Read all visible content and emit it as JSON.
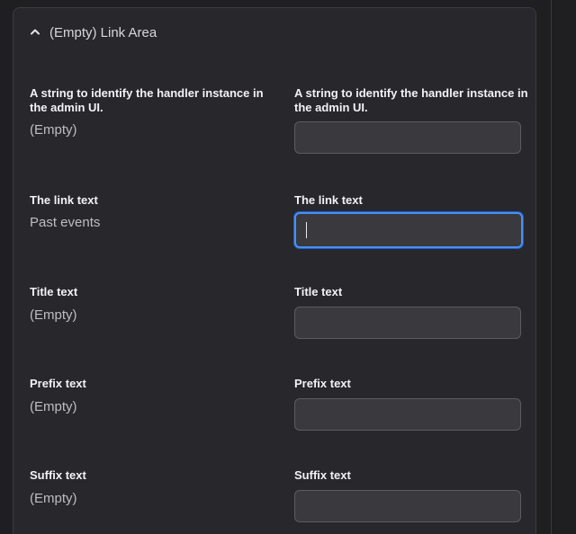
{
  "section": {
    "title": "(Empty) Link Area"
  },
  "fields": [
    {
      "left_label": "A string to identify the handler instance in the admin UI.",
      "left_value": "(Empty)",
      "right_label": "A string to identify the handler instance in the admin UI.",
      "input_value": "",
      "input_placeholder": ""
    },
    {
      "left_label": "The link text",
      "left_value": "Past events",
      "right_label": "The link text",
      "input_value": "",
      "input_placeholder": ""
    },
    {
      "left_label": "Title text",
      "left_value": "(Empty)",
      "right_label": "Title text",
      "input_value": "",
      "input_placeholder": ""
    },
    {
      "left_label": "Prefix text",
      "left_value": "(Empty)",
      "right_label": "Prefix text",
      "input_value": "",
      "input_placeholder": ""
    },
    {
      "left_label": "Suffix text",
      "left_value": "(Empty)",
      "right_label": "Suffix text",
      "input_value": "",
      "input_placeholder": ""
    }
  ],
  "icons": {
    "collapse": "chevron-up-icon"
  },
  "colors": {
    "background": "#1f1f22",
    "panel": "#28282c",
    "text": "#f2f2f4",
    "muted_text": "#bdbdc3",
    "input_bg": "#39393e",
    "focus_accent": "#4b8ff2"
  }
}
